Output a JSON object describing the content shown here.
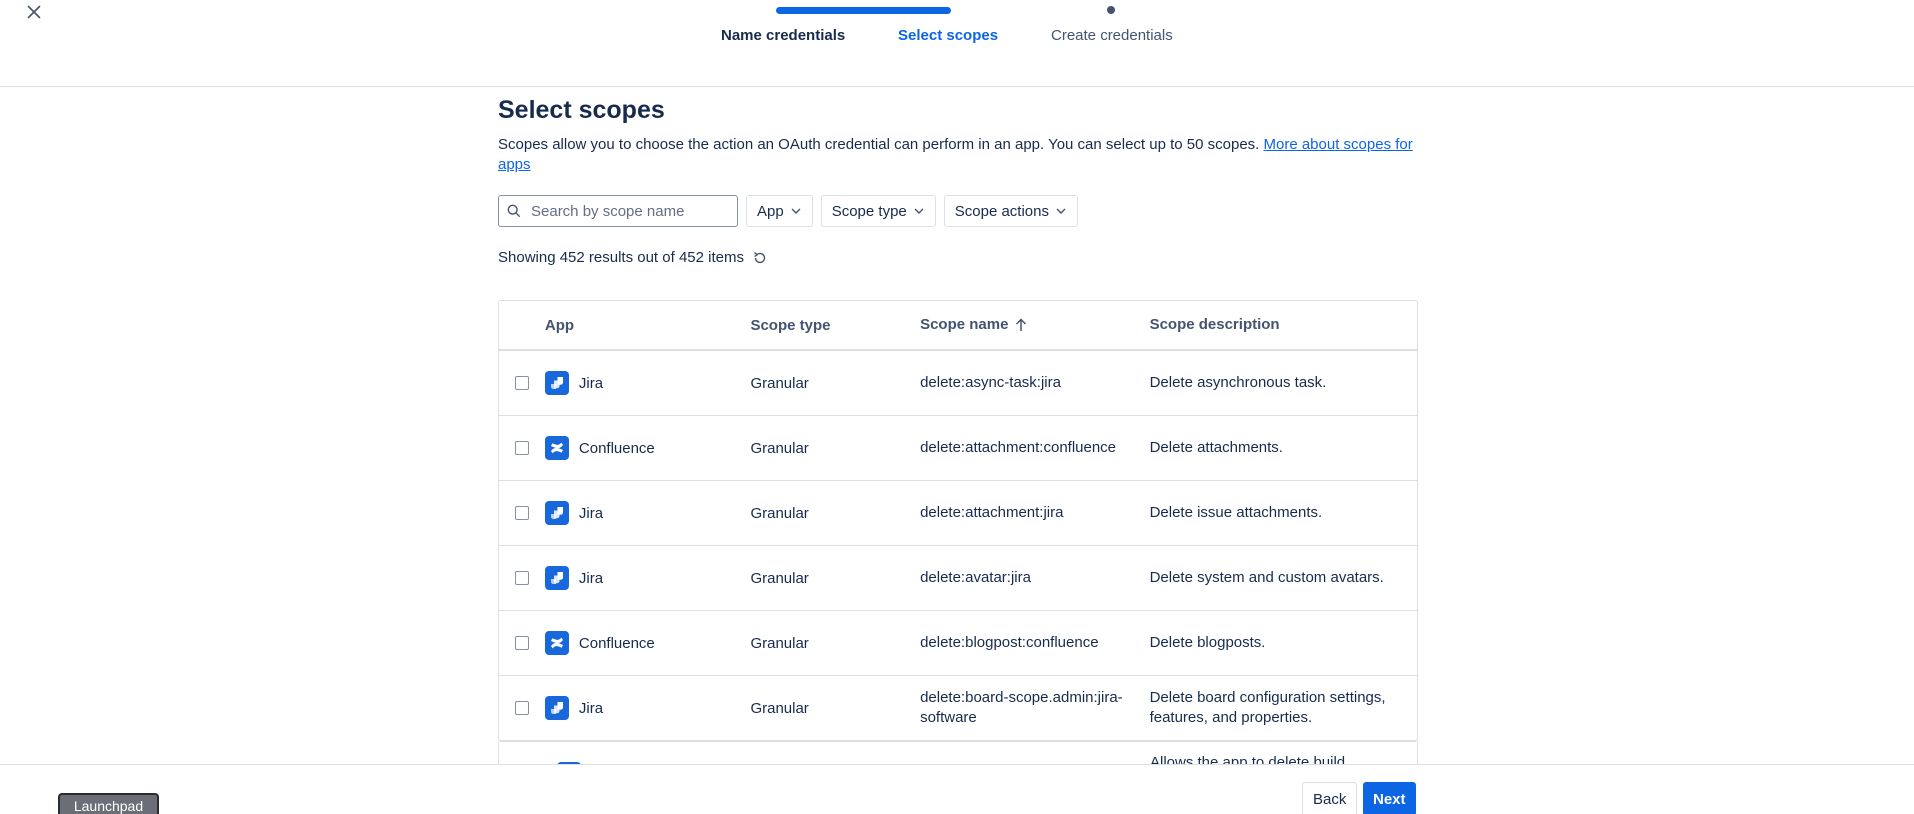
{
  "header": {
    "steps": [
      "Name credentials",
      "Select scopes",
      "Create credentials"
    ]
  },
  "main": {
    "title": "Select scopes",
    "description": "Scopes allow you to choose the action an OAuth credential can perform in an app. You can select up to 50 scopes.",
    "more_link": "More about scopes for apps",
    "search_placeholder": "Search by scope name",
    "filters": {
      "app": "App",
      "scope_type": "Scope type",
      "scope_actions": "Scope actions"
    },
    "results_text": "Showing 452 results out of 452 items"
  },
  "table": {
    "headers": {
      "app": "App",
      "scope_type": "Scope type",
      "scope_name": "Scope name",
      "scope_description": "Scope description"
    },
    "rows": [
      {
        "app": "Jira",
        "icon": "jira-icon",
        "type": "Granular",
        "name": "delete:async-task:jira",
        "description": "Delete asynchronous task."
      },
      {
        "app": "Confluence",
        "icon": "confluence-icon",
        "type": "Granular",
        "name": "delete:attachment:confluence",
        "description": "Delete attachments."
      },
      {
        "app": "Jira",
        "icon": "jira-icon",
        "type": "Granular",
        "name": "delete:attachment:jira",
        "description": "Delete issue attachments."
      },
      {
        "app": "Jira",
        "icon": "jira-icon",
        "type": "Granular",
        "name": "delete:avatar:jira",
        "description": "Delete system and custom avatars."
      },
      {
        "app": "Confluence",
        "icon": "confluence-icon",
        "type": "Granular",
        "name": "delete:blogpost:confluence",
        "description": "Delete blogposts."
      },
      {
        "app": "Jira",
        "icon": "jira-icon",
        "type": "Granular",
        "name": "delete:board-scope.admin:jira-software",
        "description": "Delete board configuration settings, features, and properties."
      }
    ],
    "partial_row_text": "Allows the app to delete build"
  },
  "footer": {
    "launchpad": "Launchpad",
    "back": "Back",
    "next": "Next"
  },
  "colors": {
    "accent": "#0c66e4",
    "app_icon": "#1868db"
  }
}
